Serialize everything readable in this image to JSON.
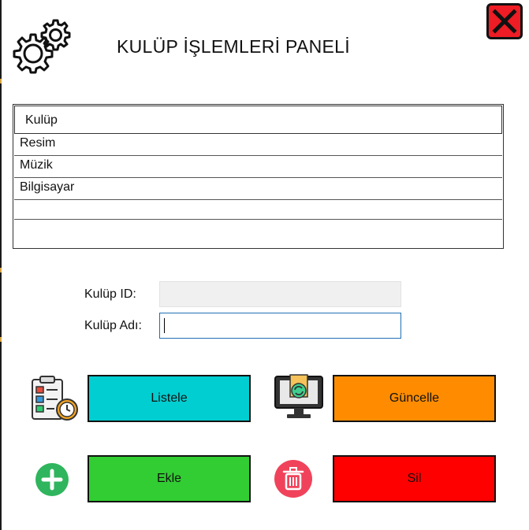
{
  "window": {
    "title": "KULÜP İŞLEMLERİ PANELİ",
    "close_icon": "close-icon",
    "gear_icon": "gear-icon"
  },
  "grid": {
    "columns": [
      "Kulüp"
    ],
    "rows": [
      [
        "Resim"
      ],
      [
        "Müzik"
      ],
      [
        "Bilgisayar"
      ],
      [
        ""
      ]
    ]
  },
  "form": {
    "id_label": "Kulüp ID:",
    "id_value": "",
    "name_label": "Kulüp Adı:",
    "name_value": ""
  },
  "buttons": {
    "list_label": "Listele",
    "update_label": "Güncelle",
    "add_label": "Ekle",
    "delete_label": "Sil"
  },
  "colors": {
    "close_red": "#ee1c24",
    "list_cyan": "#00ced1",
    "update_orange": "#ff8c00",
    "add_green": "#32cd32",
    "delete_red": "#ff0000",
    "add_circle_green": "#2fb55d",
    "delete_circle_red": "#f0435b"
  }
}
